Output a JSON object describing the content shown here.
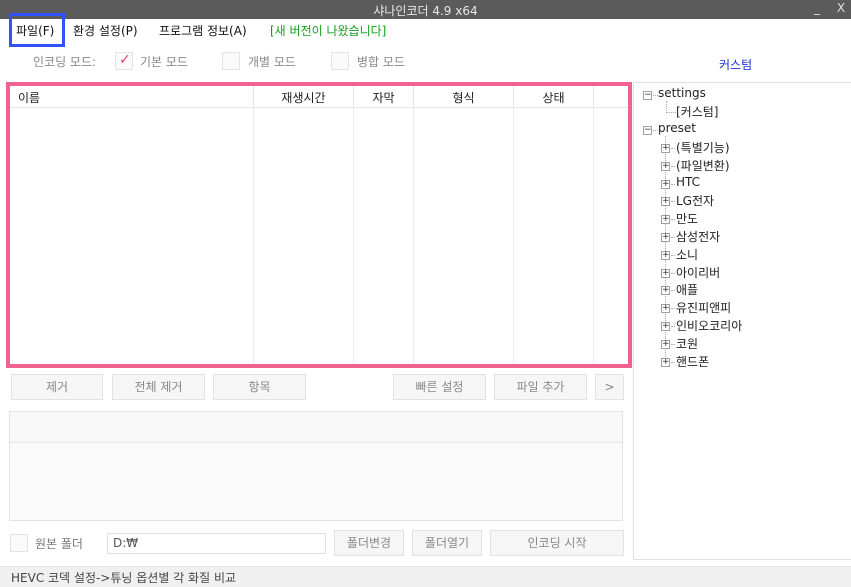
{
  "titlebar": {
    "title": "샤나인코더  4.9 x64",
    "minimize": "_",
    "close": "X"
  },
  "menu": {
    "file": "파일(F)",
    "env": "환경 설정(P)",
    "info": "프로그램 정보(A)",
    "new_version": "[새 버전이 나왔습니다]"
  },
  "modes": {
    "label": "인코딩 모드:",
    "basic": "기본 모드",
    "individual": "개별 모드",
    "merge": "병합 모드",
    "basic_checked": true
  },
  "custom_link": "커스텀",
  "file_list": {
    "columns": [
      "이름",
      "재생시간",
      "자막",
      "형식",
      "상태"
    ],
    "rows": []
  },
  "buttons": {
    "remove": "제거",
    "remove_all": "전체 제거",
    "items": "항목",
    "quick_settings": "빠른 설정",
    "add_file": "파일 추가",
    "more": ">",
    "change_folder": "폴더변경",
    "open_folder": "폴더열기",
    "start_encoding": "인코딩 시작"
  },
  "output": {
    "source_folder_label": "원본 폴더",
    "path": "D:₩"
  },
  "status": "HEVC 코덱 설정->튜닝 옵션별 각 화질 비교",
  "tree": {
    "settings": "settings",
    "settings_child": "[커스텀]",
    "preset": "preset",
    "preset_children": [
      "(특별기능)",
      "(파일변환)",
      "HTC",
      "LG전자",
      "만도",
      "삼성전자",
      "소니",
      "아이리버",
      "애플",
      "유진피앤피",
      "인비오코리아",
      "코원",
      "핸드폰"
    ]
  },
  "colors": {
    "highlight_border": "#f0638f",
    "file_menu_border": "#3251ff",
    "new_version": "#14a01d",
    "link": "#1b2fd6",
    "titlebar": "#5b5b5b"
  }
}
